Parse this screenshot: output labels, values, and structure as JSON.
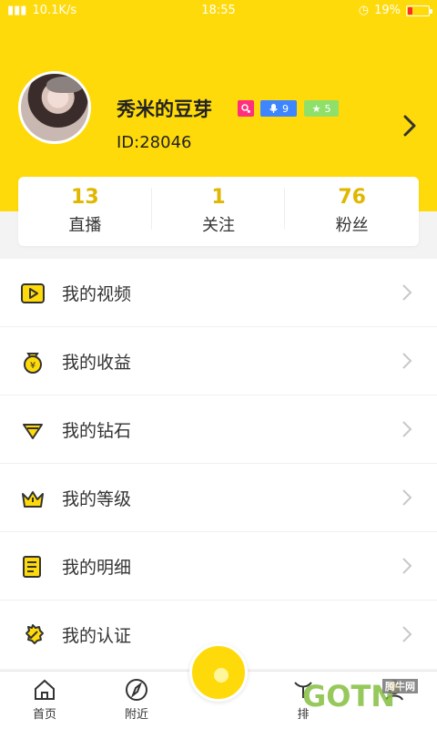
{
  "status_bar": {
    "left": "10.1K/s",
    "time": "18:55",
    "battery": "19%"
  },
  "profile": {
    "name": "秀米的豆芽",
    "badges": [
      "9",
      "5"
    ],
    "id": "ID:28046",
    "stats": [
      {
        "value": "13",
        "label": "直播"
      },
      {
        "value": "1",
        "label": "关注"
      },
      {
        "value": "76",
        "label": "粉丝"
      }
    ]
  },
  "menu": [
    {
      "label": "我的视频",
      "icon": "video-icon"
    },
    {
      "label": "我的收益",
      "icon": "money-bag-icon"
    },
    {
      "label": "我的钻石",
      "icon": "diamond-icon"
    },
    {
      "label": "我的等级",
      "icon": "crown-icon"
    },
    {
      "label": "我的明细",
      "icon": "document-icon"
    },
    {
      "label": "我的认证",
      "icon": "verified-badge-icon"
    }
  ],
  "tabbar": {
    "home": "首页",
    "nearby": "附近",
    "rank": "排",
    "me": ""
  },
  "watermark": {
    "text": "GOTN",
    "tag": "腾牛网"
  },
  "colors": {
    "brand": "#FFDA0A",
    "accent_text": "#E0B700",
    "badge_pink": "#FF2F7D",
    "badge_blue": "#3E86FF",
    "badge_green": "#8FE06A"
  }
}
